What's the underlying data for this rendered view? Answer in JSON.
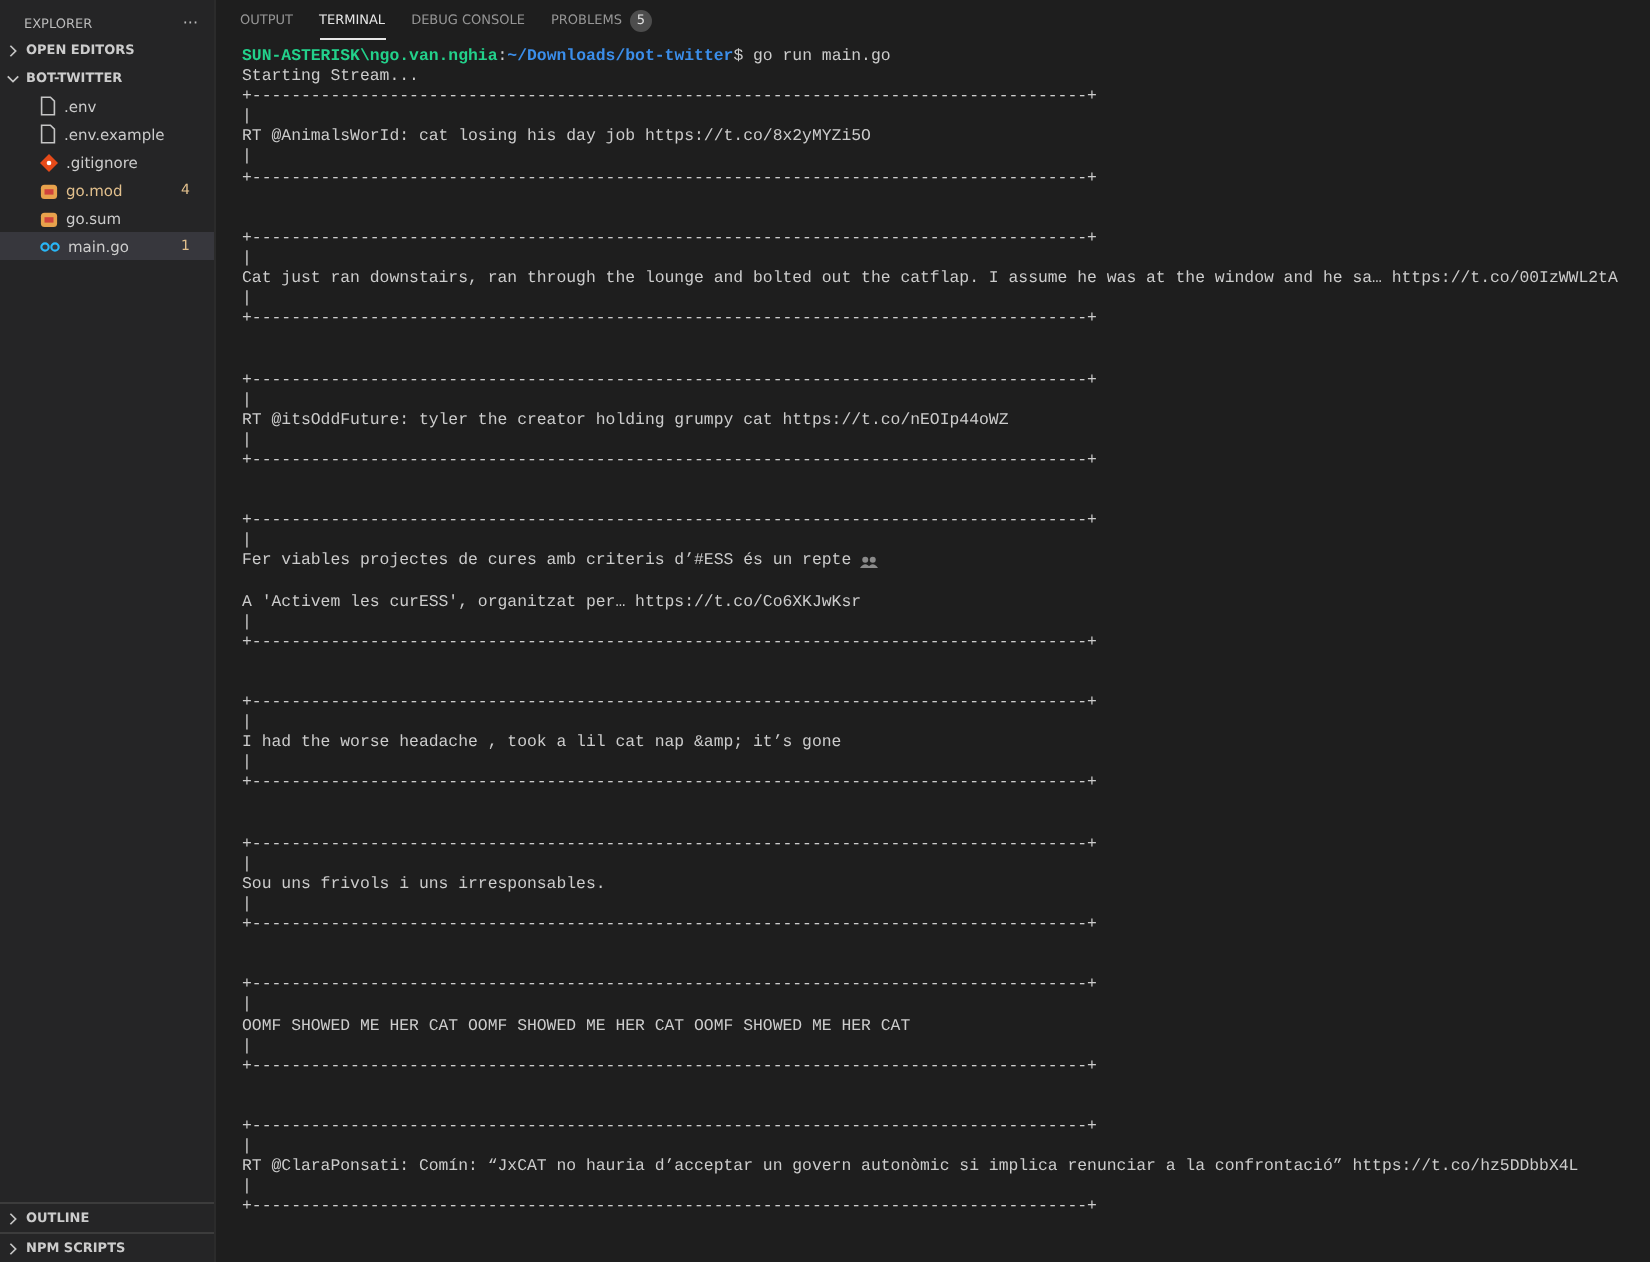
{
  "sidebar": {
    "title": "EXPLORER",
    "more": "···",
    "sections": [
      {
        "label": "OPEN EDITORS",
        "expanded": false
      },
      {
        "label": "BOT-TWITTER",
        "expanded": true,
        "files": [
          {
            "name": ".env",
            "kind": "file",
            "modified": false,
            "selected": false
          },
          {
            "name": ".env.example",
            "kind": "file",
            "modified": false,
            "selected": false
          },
          {
            "name": ".gitignore",
            "kind": "git",
            "modified": false,
            "selected": false
          },
          {
            "name": "go.mod",
            "kind": "gomod",
            "modified": true,
            "badge": "4",
            "selected": false
          },
          {
            "name": "go.sum",
            "kind": "gomod",
            "modified": false,
            "selected": false
          },
          {
            "name": "main.go",
            "kind": "golang",
            "modified": false,
            "badge": "1",
            "selected": true
          }
        ]
      }
    ],
    "bottom_sections": [
      {
        "label": "OUTLINE",
        "expanded": false
      },
      {
        "label": "NPM SCRIPTS",
        "expanded": false
      }
    ]
  },
  "panel_tabs": [
    {
      "label": "OUTPUT",
      "selected": false
    },
    {
      "label": "TERMINAL",
      "selected": true
    },
    {
      "label": "DEBUG CONSOLE",
      "selected": false
    },
    {
      "label": "PROBLEMS",
      "selected": false,
      "badge": "5"
    }
  ],
  "terminal": {
    "lines": [
      {
        "kind": "prompt",
        "user": "SUN-ASTERISK\\ngo.van.nghia",
        "sep": ":",
        "path": "~/Downloads/bot-twitter",
        "command": "$ go run main.go"
      },
      {
        "kind": "out",
        "text": "Starting Stream..."
      },
      {
        "kind": "out",
        "text": "+-------------------------------------------------------------------------------------+"
      },
      {
        "kind": "out",
        "text": "|"
      },
      {
        "kind": "out",
        "text": "RT @AnimalsWorId: cat losing his day job https://t.co/8x2yMYZi5O"
      },
      {
        "kind": "out",
        "text": "|"
      },
      {
        "kind": "out",
        "text": "+-------------------------------------------------------------------------------------+"
      },
      {
        "kind": "blank"
      },
      {
        "kind": "blank"
      },
      {
        "kind": "out",
        "text": "+-------------------------------------------------------------------------------------+"
      },
      {
        "kind": "out",
        "text": "|"
      },
      {
        "kind": "out",
        "text": "Cat just ran downstairs, ran through the lounge and bolted out the catflap. I assume he was at the window and he sa… https://t.co/00IzWWL2tA"
      },
      {
        "kind": "out",
        "text": "|"
      },
      {
        "kind": "out",
        "text": "+-------------------------------------------------------------------------------------+"
      },
      {
        "kind": "blank"
      },
      {
        "kind": "blank"
      },
      {
        "kind": "out",
        "text": "+-------------------------------------------------------------------------------------+"
      },
      {
        "kind": "out",
        "text": "|"
      },
      {
        "kind": "out",
        "text": "RT @itsOddFuture: tyler the creator holding grumpy cat https://t.co/nEOIp44oWZ"
      },
      {
        "kind": "out",
        "text": "|"
      },
      {
        "kind": "out",
        "text": "+-------------------------------------------------------------------------------------+"
      },
      {
        "kind": "blank"
      },
      {
        "kind": "blank"
      },
      {
        "kind": "out",
        "text": "+-------------------------------------------------------------------------------------+"
      },
      {
        "kind": "out",
        "text": "|"
      },
      {
        "kind": "out",
        "text": "Fer viables projectes de cures amb criteris d’#ESS és un repte",
        "trailing_icon": true
      },
      {
        "kind": "blank"
      },
      {
        "kind": "out",
        "text": "A 'Activem les curESS', organitzat per… https://t.co/Co6XKJwKsr"
      },
      {
        "kind": "out",
        "text": "|"
      },
      {
        "kind": "out",
        "text": "+-------------------------------------------------------------------------------------+"
      },
      {
        "kind": "blank"
      },
      {
        "kind": "blank"
      },
      {
        "kind": "out",
        "text": "+-------------------------------------------------------------------------------------+"
      },
      {
        "kind": "out",
        "text": "|"
      },
      {
        "kind": "out",
        "text": "I had the worse headache , took a lil cat nap &amp; it’s gone"
      },
      {
        "kind": "out",
        "text": "|"
      },
      {
        "kind": "out",
        "text": "+-------------------------------------------------------------------------------------+"
      },
      {
        "kind": "blank"
      },
      {
        "kind": "blank"
      },
      {
        "kind": "out",
        "text": "+-------------------------------------------------------------------------------------+"
      },
      {
        "kind": "out",
        "text": "|"
      },
      {
        "kind": "out",
        "text": "Sou uns frivols i uns irresponsables."
      },
      {
        "kind": "out",
        "text": "|"
      },
      {
        "kind": "out",
        "text": "+-------------------------------------------------------------------------------------+"
      },
      {
        "kind": "blank"
      },
      {
        "kind": "blank"
      },
      {
        "kind": "out",
        "text": "+-------------------------------------------------------------------------------------+"
      },
      {
        "kind": "out",
        "text": "|"
      },
      {
        "kind": "out",
        "text": "OOMF SHOWED ME HER CAT OOMF SHOWED ME HER CAT OOMF SHOWED ME HER CAT"
      },
      {
        "kind": "out",
        "text": "|"
      },
      {
        "kind": "out",
        "text": "+-------------------------------------------------------------------------------------+"
      },
      {
        "kind": "blank"
      },
      {
        "kind": "blank"
      },
      {
        "kind": "out",
        "text": "+-------------------------------------------------------------------------------------+"
      },
      {
        "kind": "out",
        "text": "|"
      },
      {
        "kind": "out",
        "text": "RT @ClaraPonsati: Comín: “JxCAT no hauria d’acceptar un govern autonòmic si implica renunciar a la confrontació” https://t.co/hz5DDbbX4L"
      },
      {
        "kind": "out",
        "text": "|"
      },
      {
        "kind": "out",
        "text": "+-------------------------------------------------------------------------------------+"
      }
    ]
  }
}
